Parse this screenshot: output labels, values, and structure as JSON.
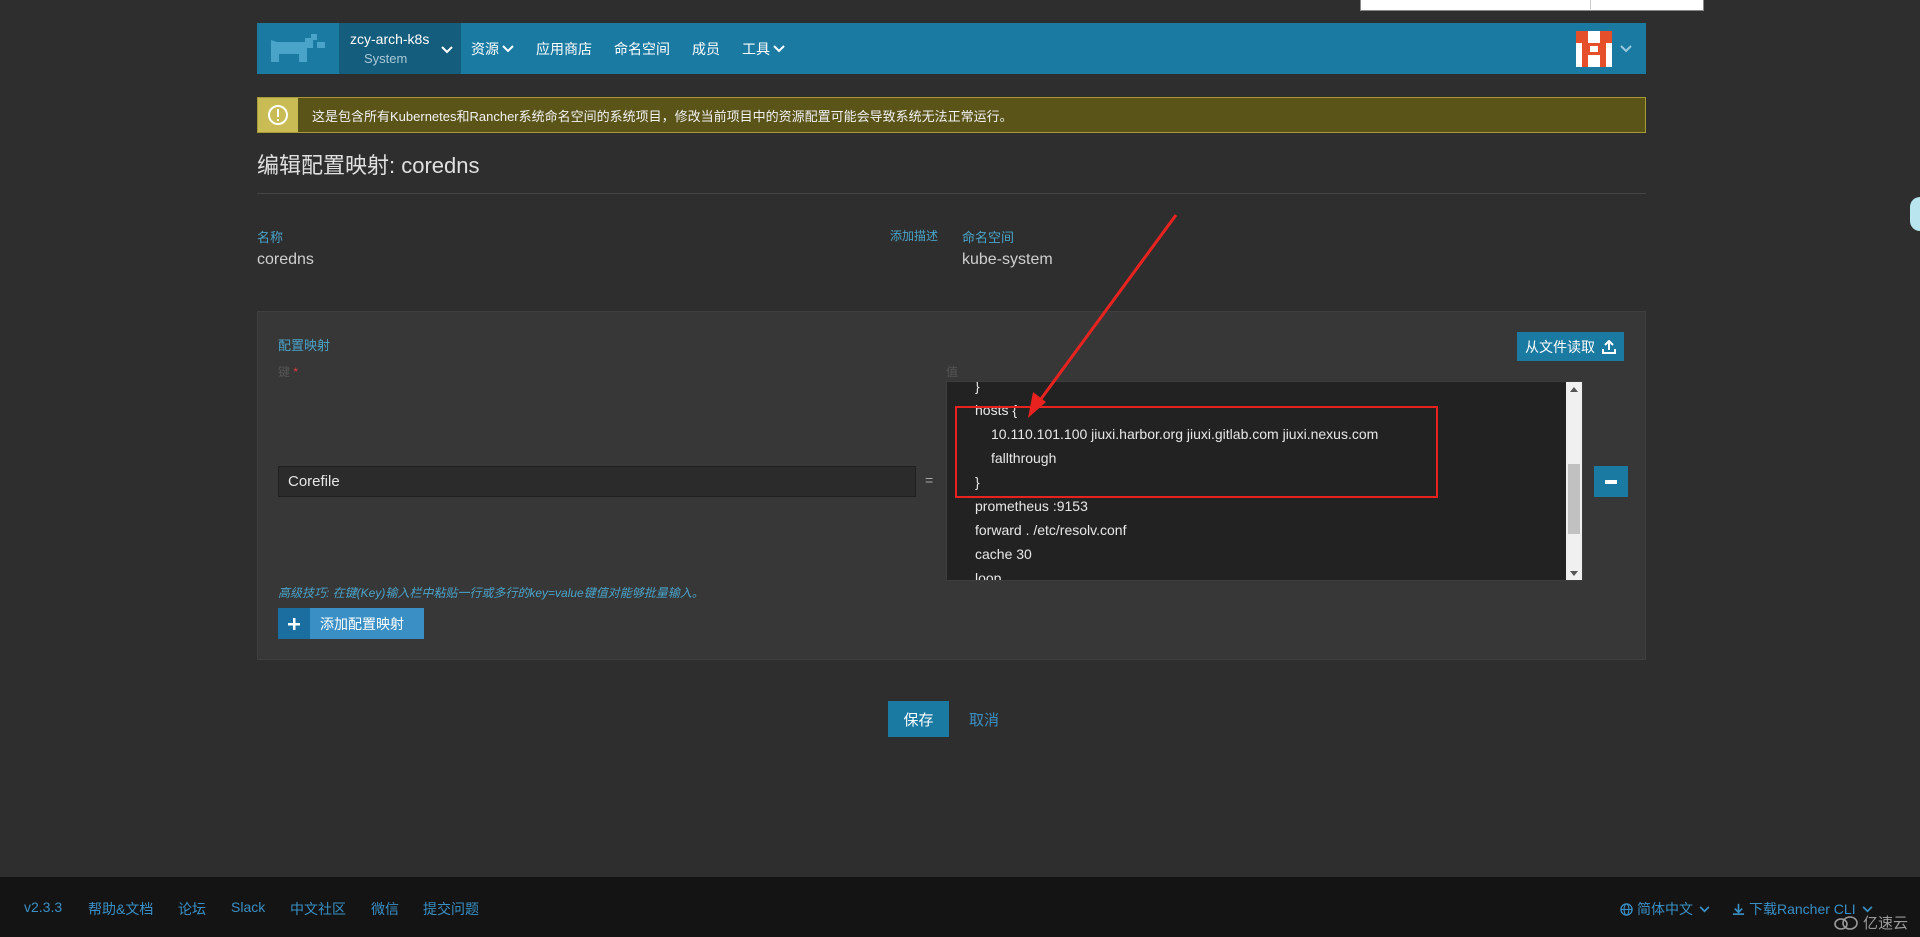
{
  "header": {
    "cluster_name": "zcy-arch-k8s",
    "project_name": "System",
    "nav": [
      "资源",
      "应用商店",
      "命名空间",
      "成员",
      "工具"
    ]
  },
  "banner": {
    "text": "这是包含所有Kubernetes和Rancher系统命名空间的系统项目，修改当前项目中的资源配置可能会导致系统无法正常运行。"
  },
  "page": {
    "title": "编辑配置映射: coredns",
    "name_label": "名称",
    "name_value": "coredns",
    "add_description": "添加描述",
    "namespace_label": "命名空间",
    "namespace_value": "kube-system"
  },
  "configmap": {
    "section_title": "配置映射",
    "key_label": "键",
    "required_mark": "*",
    "value_label": "值",
    "read_file_button": "从文件读取",
    "entries": [
      {
        "key": "Corefile",
        "value_lines": [
          "}",
          "hosts {",
          "10.110.101.100 jiuxi.harbor.org jiuxi.gitlab.com jiuxi.nexus.com",
          "fallthrough",
          "}",
          "prometheus :9153",
          "forward . /etc/resolv.conf",
          "cache 30",
          "loop"
        ]
      }
    ],
    "equals": "=",
    "tip": "高级技巧: 在键(Key)输入栏中粘贴一行或多行的key=value键值对能够批量输入。",
    "add_button": "添加配置映射"
  },
  "actions": {
    "save": "保存",
    "cancel": "取消"
  },
  "footer": {
    "version": "v2.3.3",
    "links": [
      "帮助&文档",
      "论坛",
      "Slack",
      "中文社区",
      "微信",
      "提交问题"
    ],
    "language": "简体中文",
    "download": "下载Rancher CLI"
  },
  "watermark": "亿速云",
  "colors": {
    "accent": "#1a7aa2",
    "warning_bg": "#5a5419",
    "annotation": "#e8231f"
  }
}
